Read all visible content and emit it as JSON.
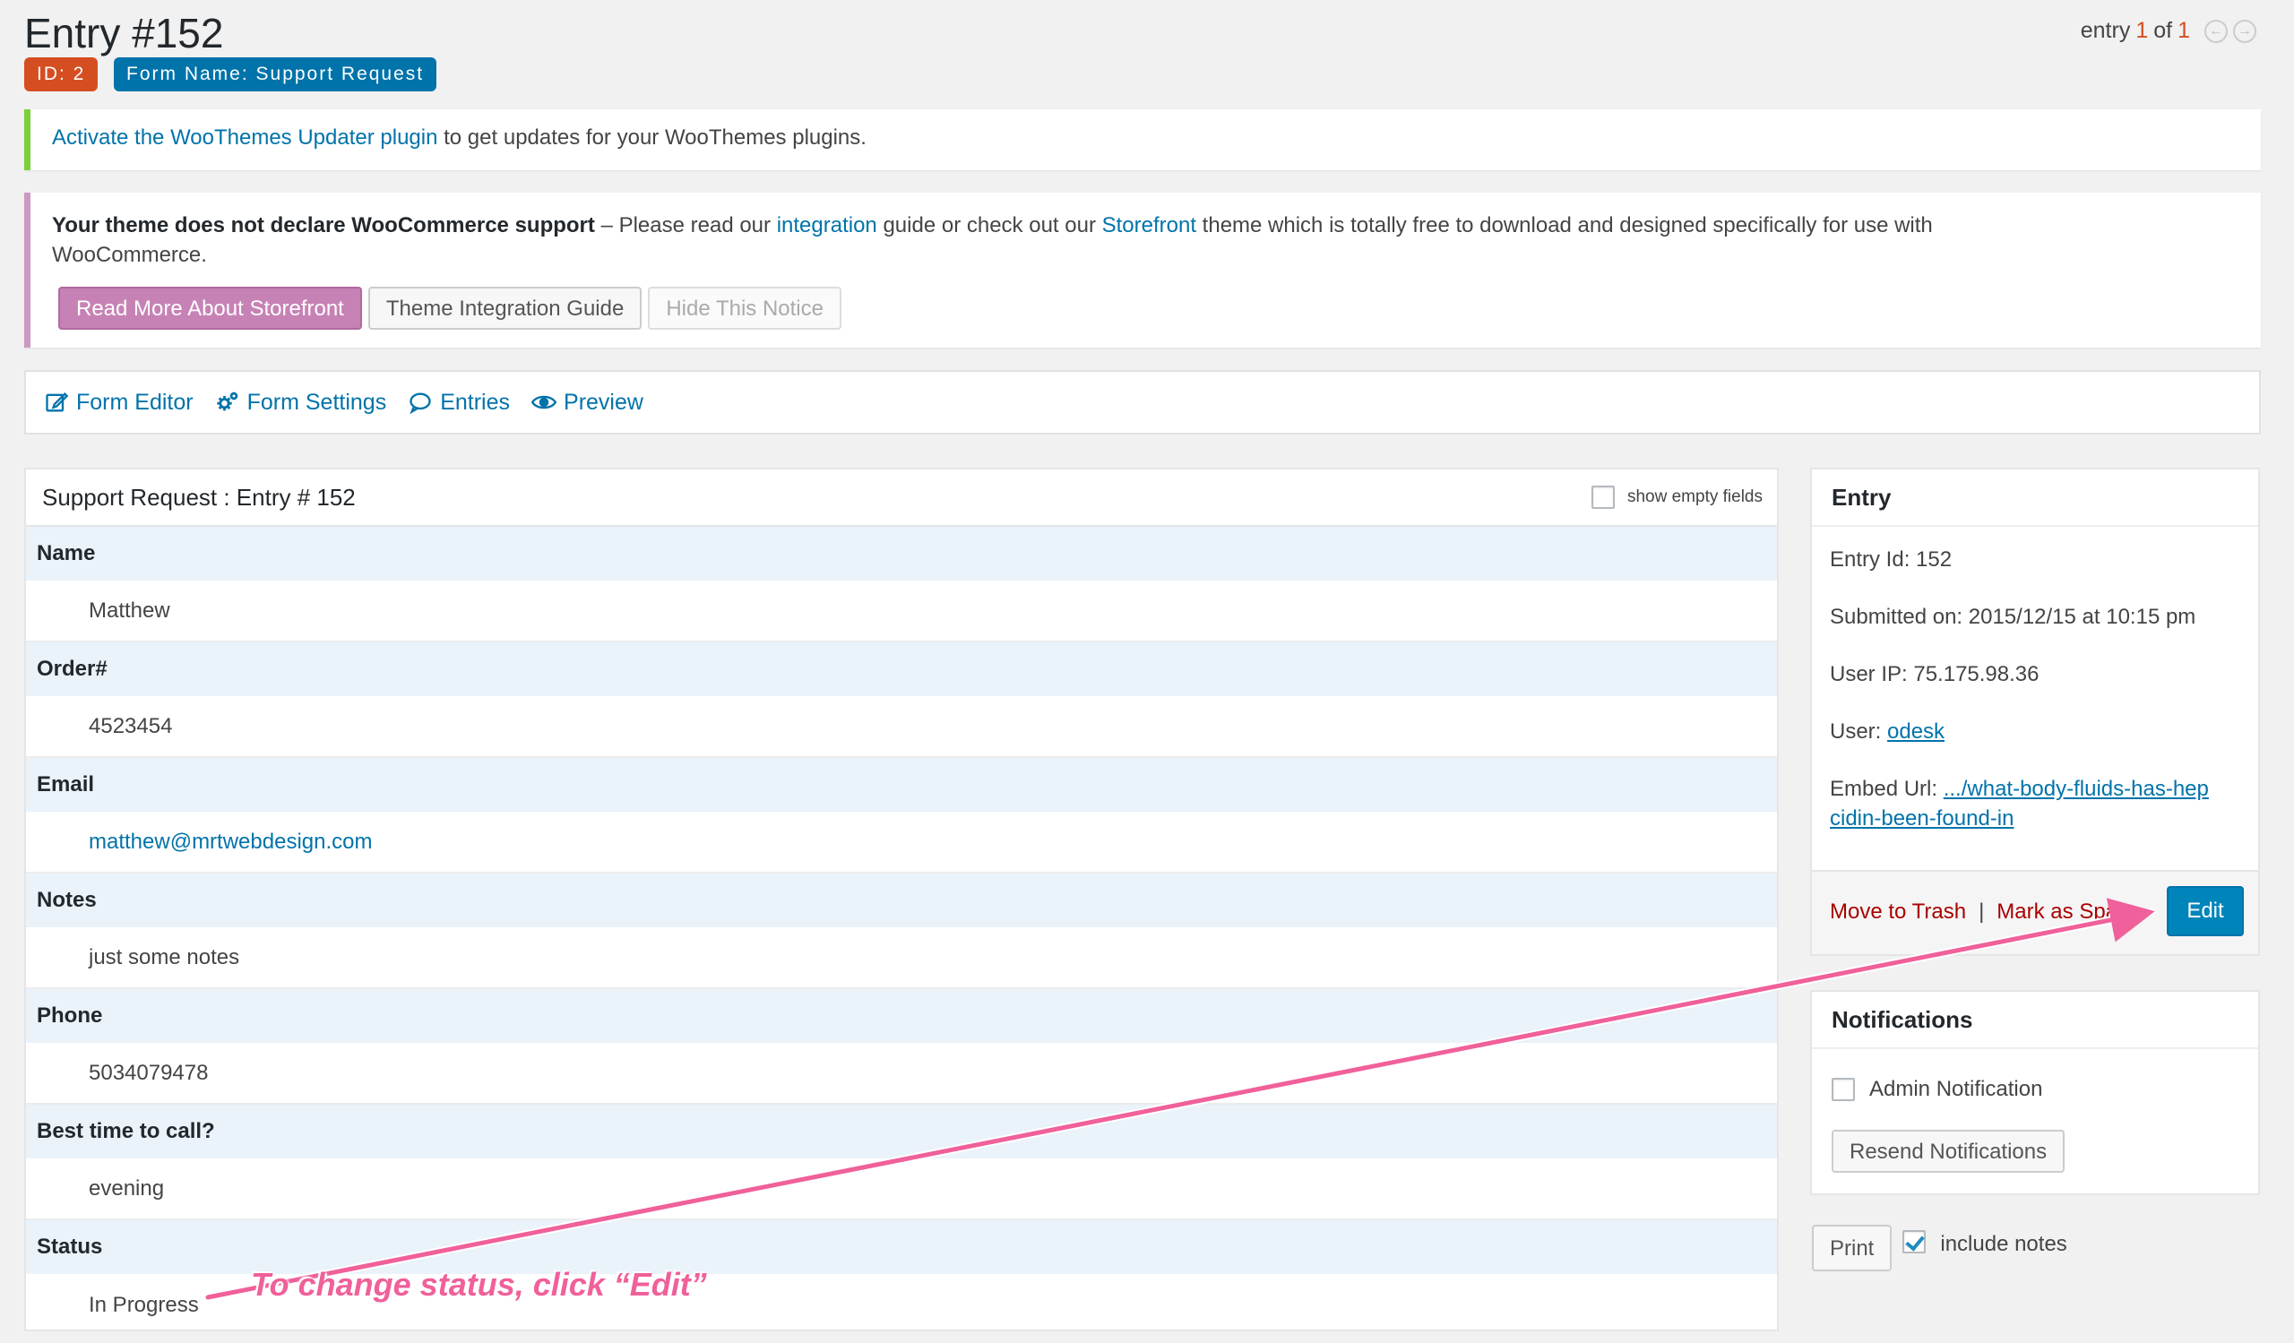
{
  "header": {
    "title": "Entry #152",
    "badge_id": "ID: 2",
    "badge_form": "Form Name: Support Request",
    "pager_prefix": "entry",
    "pager_current": "1",
    "pager_of": "of",
    "pager_total": "1"
  },
  "notices": {
    "updater_link": "Activate the WooThemes Updater plugin",
    "updater_rest": "to get updates for your WooThemes plugins.",
    "woo_bold": "Your theme does not declare WooCommerce support",
    "woo_text1": "– Please read our",
    "woo_link1": "integration",
    "woo_text2": "guide or check out our",
    "woo_link2": "Storefront",
    "woo_text3": "theme which is totally free to download and designed specifically for use with WooCommerce.",
    "btn_storefront": "Read More About Storefront",
    "btn_guide": "Theme Integration Guide",
    "btn_hide": "Hide This Notice"
  },
  "toolbar": {
    "form_editor": "Form Editor",
    "form_settings": "Form Settings",
    "entries": "Entries",
    "preview": "Preview"
  },
  "entry": {
    "heading": "Support Request : Entry # 152",
    "show_empty": "show empty fields",
    "fields": [
      {
        "label": "Name",
        "value": "Matthew"
      },
      {
        "label": "Order#",
        "value": "4523454"
      },
      {
        "label": "Email",
        "value": "matthew@mrtwebdesign.com"
      },
      {
        "label": "Notes",
        "value": "just some notes"
      },
      {
        "label": "Phone",
        "value": "5034079478"
      },
      {
        "label": "Best time to call?",
        "value": "evening"
      },
      {
        "label": "Status",
        "value": "In Progress"
      }
    ]
  },
  "sidebar": {
    "entry_title": "Entry",
    "entry_id": "Entry Id: 152",
    "submitted": "Submitted on: 2015/12/15 at 10:15 pm",
    "user_ip": "User IP: 75.175.98.36",
    "user_label": "User:",
    "user_link": "odesk",
    "embed_label": "Embed Url:",
    "embed_link": ".../what-body-fluids-has-hepcidin-been-found-in",
    "move_trash": "Move to Trash",
    "divider": "|",
    "mark_spam": "Mark as Spam",
    "edit": "Edit",
    "notifications_title": "Notifications",
    "admin_notification": "Admin Notification",
    "resend": "Resend Notifications",
    "print": "Print",
    "include_notes": "include notes"
  },
  "annotation": {
    "text": "To change status, click “Edit”",
    "color": "#f0609a"
  }
}
